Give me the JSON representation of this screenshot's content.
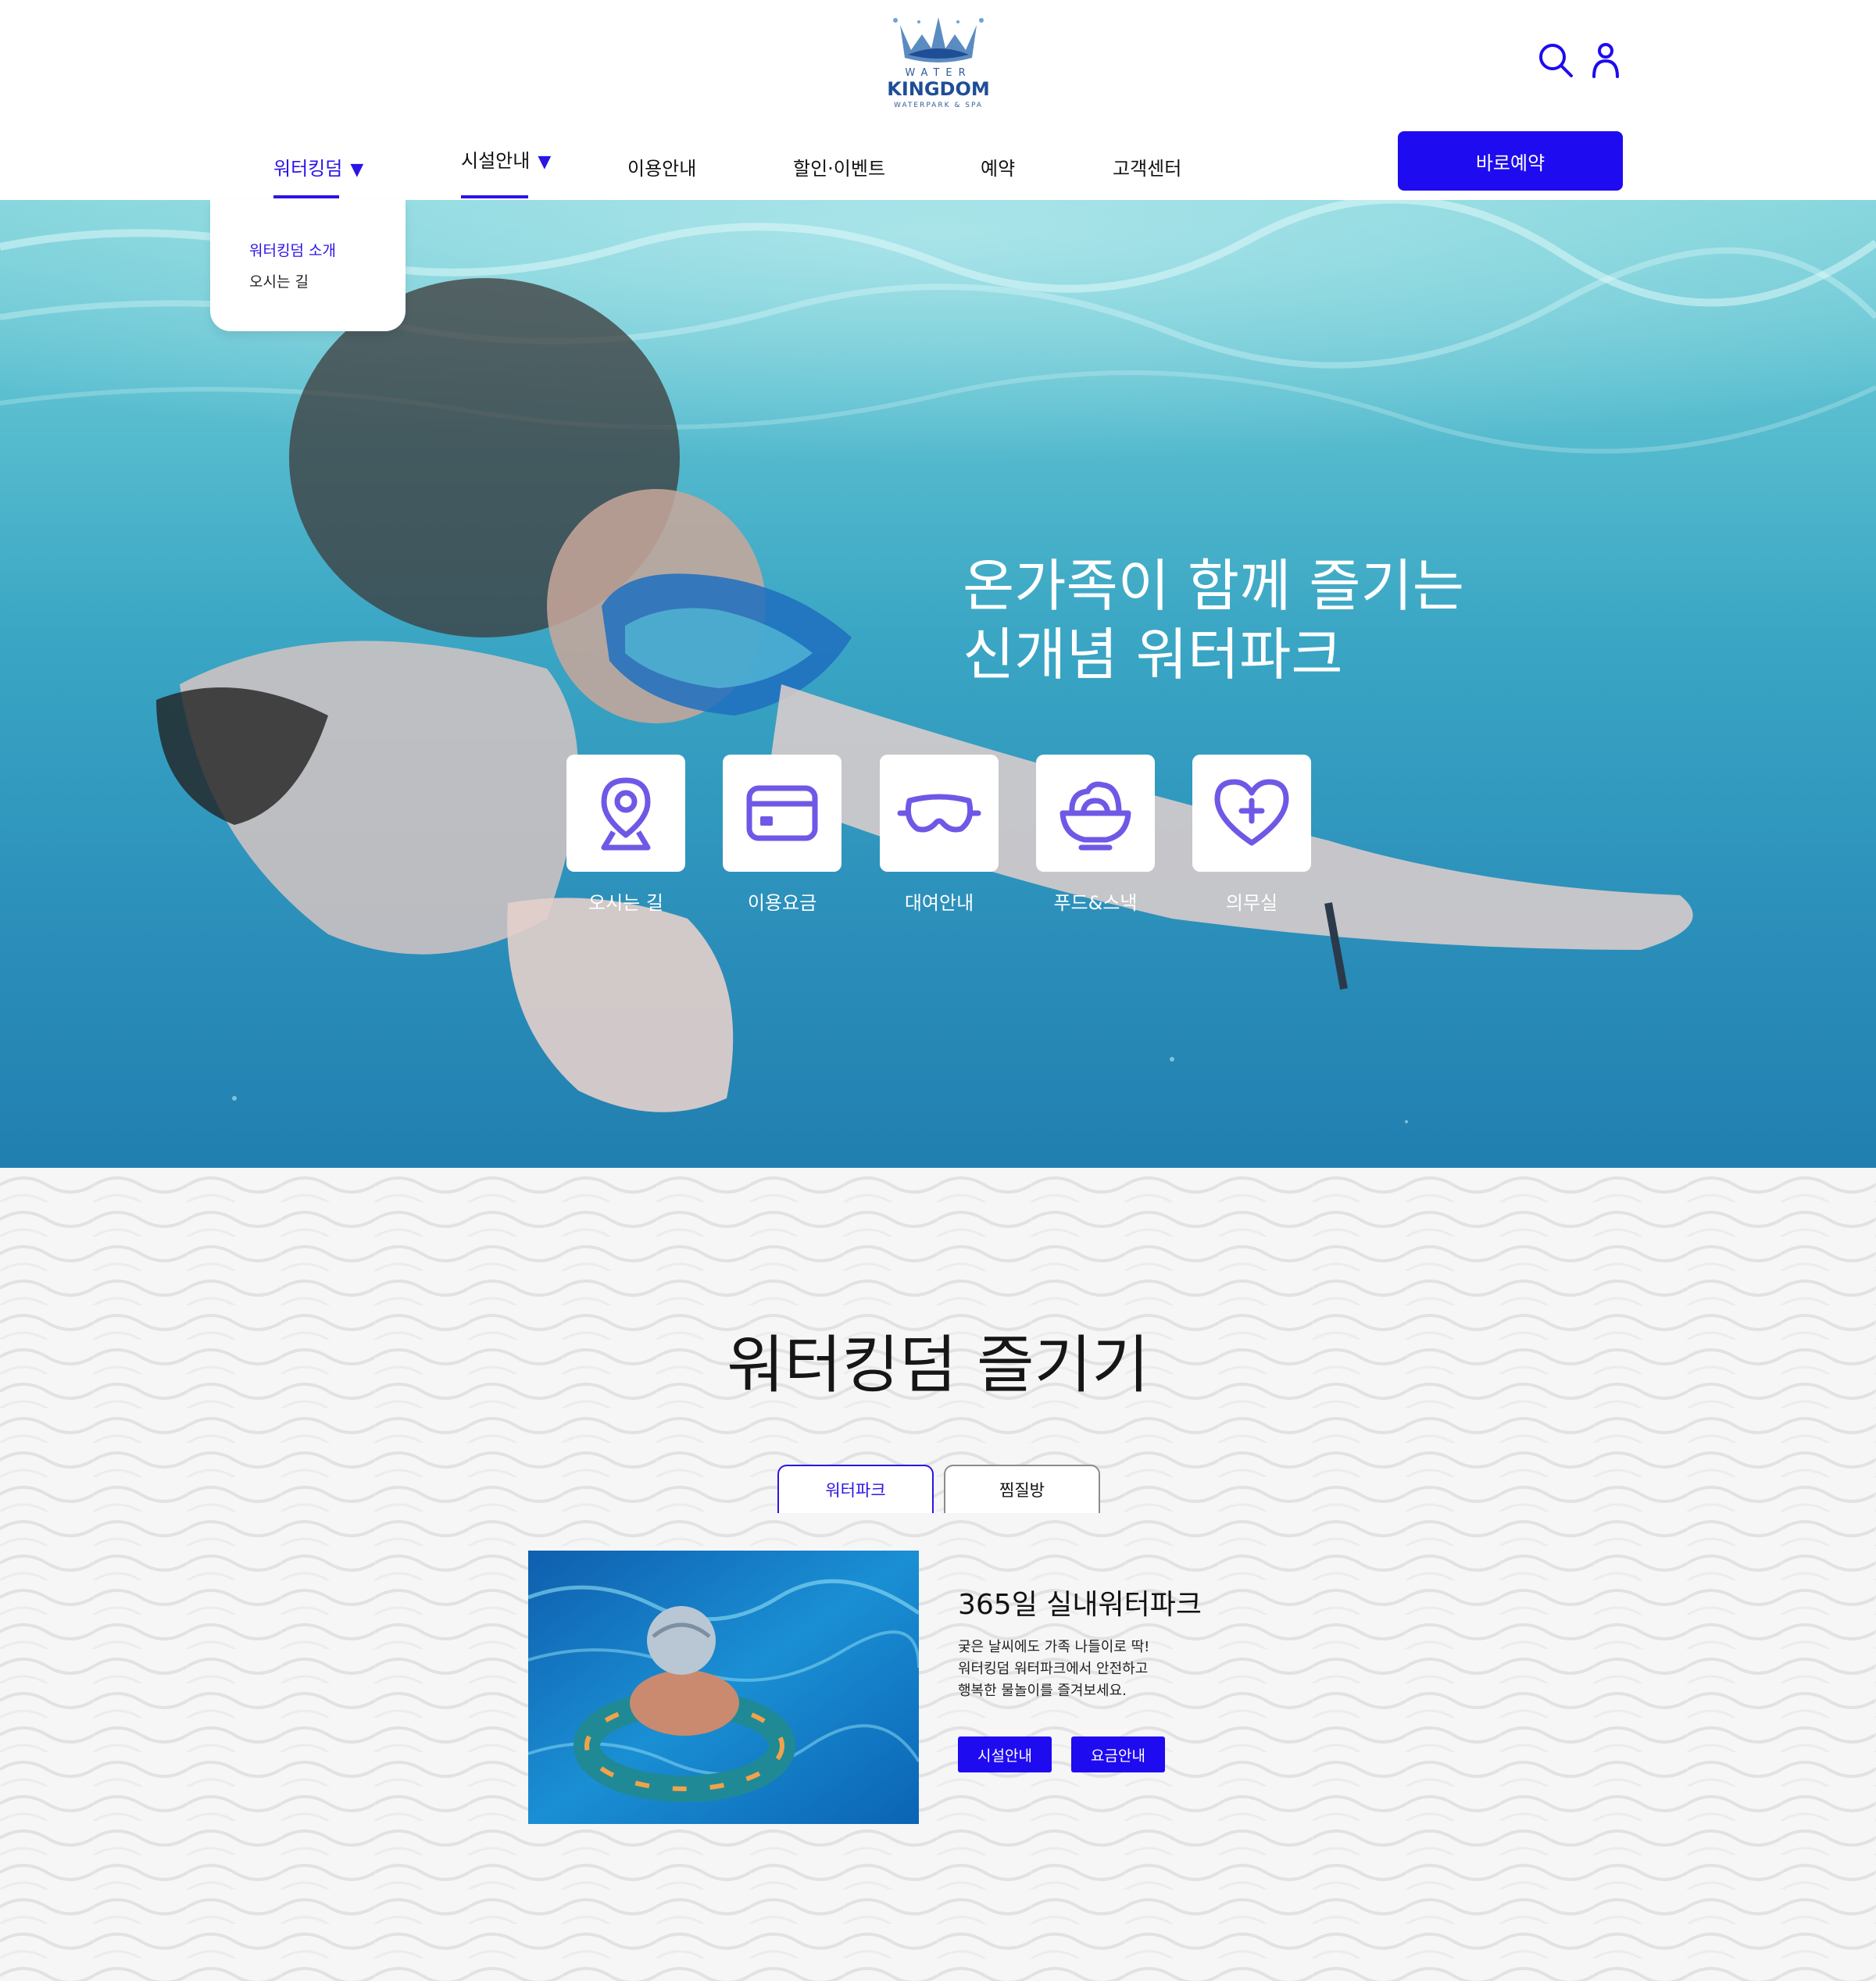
{
  "brand": {
    "logo_top": "WATER",
    "logo_main": "KINGDOM",
    "logo_sub": "WATERPARK & SPA"
  },
  "header": {
    "nav": [
      {
        "label": "워터킹덤",
        "caret": "▼"
      },
      {
        "label": "시설안내",
        "caret": "▼"
      },
      {
        "label": "이용안내"
      },
      {
        "label": "할인·이벤트"
      },
      {
        "label": "예약"
      },
      {
        "label": "고객센터"
      }
    ],
    "reserve_label": "바로예약",
    "icons": [
      "search-icon",
      "user-icon"
    ]
  },
  "dropdown": {
    "items": [
      "워터킹덤 소개",
      "오시는 길"
    ]
  },
  "hero": {
    "title_line1": "온가족이 함께 즐기는",
    "title_line2": "신개념 워터파크",
    "quick_links": [
      {
        "label": "오시는 길",
        "icon": "location-pin-icon"
      },
      {
        "label": "이용요금",
        "icon": "card-icon"
      },
      {
        "label": "대여안내",
        "icon": "goggles-icon"
      },
      {
        "label": "푸드&스낵",
        "icon": "food-bowl-icon"
      },
      {
        "label": "의무실",
        "icon": "heart-plus-icon"
      }
    ]
  },
  "enjoy": {
    "title": "워터킹덤 즐기기",
    "tabs": [
      "워터파크",
      "찜질방"
    ],
    "card": {
      "title": "365일 실내워터파크",
      "desc_lines": [
        "궂은 날씨에도 가족 나들이로 딱!",
        "워터킹덤 워터파크에서 안전하고",
        "행복한 물놀이를 즐겨보세요."
      ],
      "buttons": [
        "시설안내",
        "요금안내"
      ]
    }
  },
  "colors": {
    "accent": "#1e0bf0",
    "accent_text": "#2a14e8",
    "icon_purple": "#6f58e6"
  }
}
